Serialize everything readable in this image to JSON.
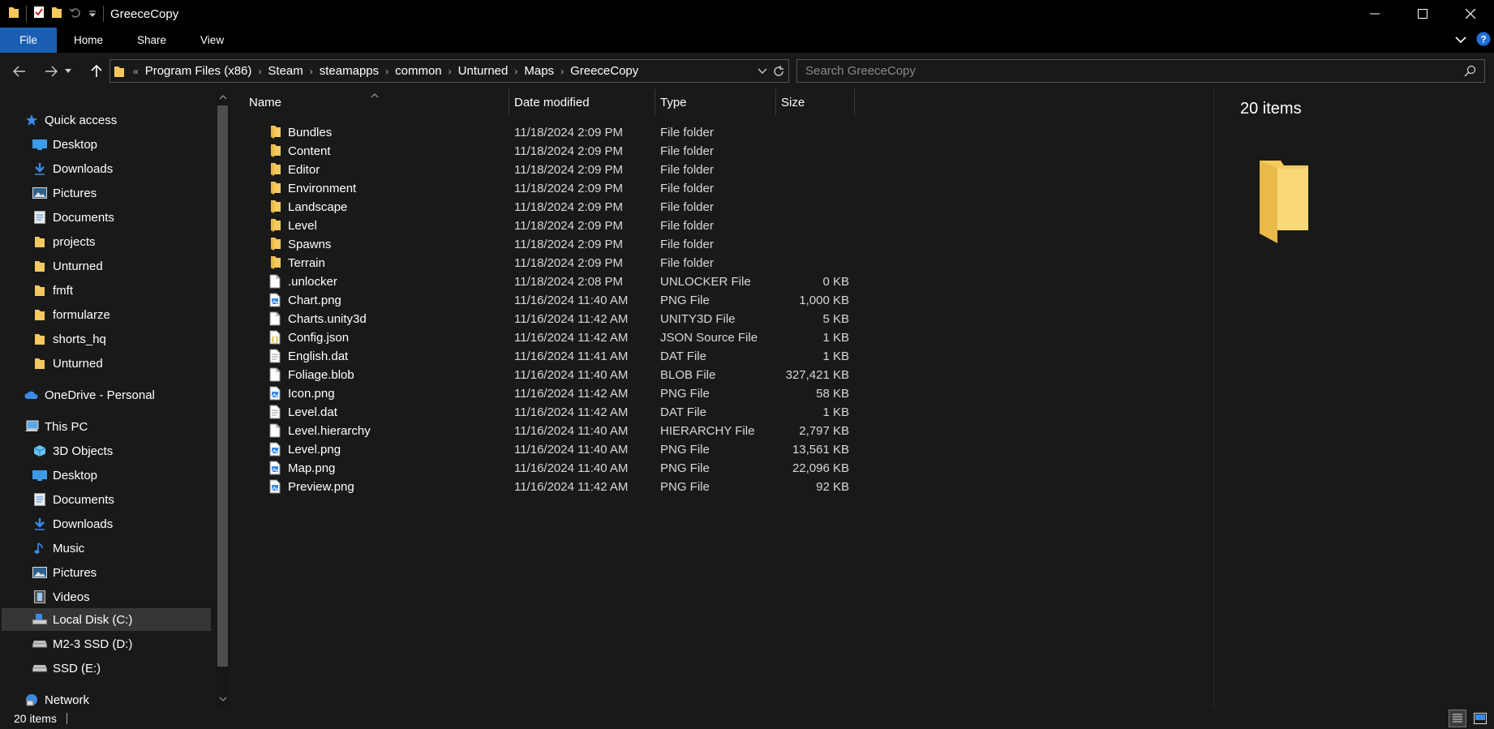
{
  "window": {
    "title": "GreeceCopy"
  },
  "ribbon": {
    "tabs": [
      "File",
      "Home",
      "Share",
      "View"
    ]
  },
  "address": {
    "overflow": "«",
    "crumbs": [
      "Program Files (x86)",
      "Steam",
      "steamapps",
      "common",
      "Unturned",
      "Maps",
      "GreeceCopy"
    ]
  },
  "search": {
    "placeholder": "Search GreeceCopy"
  },
  "nav": {
    "quick_access": "Quick access",
    "quick_items": [
      "Desktop",
      "Downloads",
      "Pictures",
      "Documents",
      "projects",
      "Unturned",
      "fmft",
      "formularze",
      "shorts_hq",
      "Unturned"
    ],
    "onedrive": "OneDrive - Personal",
    "this_pc": "This PC",
    "pc_items": [
      "3D Objects",
      "Desktop",
      "Documents",
      "Downloads",
      "Music",
      "Pictures",
      "Videos",
      "Local Disk (C:)",
      "M2-3 SSD (D:)",
      "SSD (E:)"
    ],
    "network": "Network"
  },
  "columns": {
    "name": "Name",
    "date": "Date modified",
    "type": "Type",
    "size": "Size"
  },
  "files": [
    {
      "name": "Bundles",
      "date": "11/18/2024 2:09 PM",
      "type": "File folder",
      "size": "",
      "icon": "folder"
    },
    {
      "name": "Content",
      "date": "11/18/2024 2:09 PM",
      "type": "File folder",
      "size": "",
      "icon": "folder"
    },
    {
      "name": "Editor",
      "date": "11/18/2024 2:09 PM",
      "type": "File folder",
      "size": "",
      "icon": "folder"
    },
    {
      "name": "Environment",
      "date": "11/18/2024 2:09 PM",
      "type": "File folder",
      "size": "",
      "icon": "folder"
    },
    {
      "name": "Landscape",
      "date": "11/18/2024 2:09 PM",
      "type": "File folder",
      "size": "",
      "icon": "folder"
    },
    {
      "name": "Level",
      "date": "11/18/2024 2:09 PM",
      "type": "File folder",
      "size": "",
      "icon": "folder"
    },
    {
      "name": "Spawns",
      "date": "11/18/2024 2:09 PM",
      "type": "File folder",
      "size": "",
      "icon": "folder"
    },
    {
      "name": "Terrain",
      "date": "11/18/2024 2:09 PM",
      "type": "File folder",
      "size": "",
      "icon": "folder"
    },
    {
      "name": ".unlocker",
      "date": "11/18/2024 2:08 PM",
      "type": "UNLOCKER File",
      "size": "0 KB",
      "icon": "file"
    },
    {
      "name": "Chart.png",
      "date": "11/16/2024 11:40 AM",
      "type": "PNG File",
      "size": "1,000 KB",
      "icon": "image"
    },
    {
      "name": "Charts.unity3d",
      "date": "11/16/2024 11:42 AM",
      "type": "UNITY3D File",
      "size": "5 KB",
      "icon": "file"
    },
    {
      "name": "Config.json",
      "date": "11/16/2024 11:42 AM",
      "type": "JSON Source File",
      "size": "1 KB",
      "icon": "json"
    },
    {
      "name": "English.dat",
      "date": "11/16/2024 11:41 AM",
      "type": "DAT File",
      "size": "1 KB",
      "icon": "text"
    },
    {
      "name": "Foliage.blob",
      "date": "11/16/2024 11:40 AM",
      "type": "BLOB File",
      "size": "327,421 KB",
      "icon": "file"
    },
    {
      "name": "Icon.png",
      "date": "11/16/2024 11:42 AM",
      "type": "PNG File",
      "size": "58 KB",
      "icon": "image"
    },
    {
      "name": "Level.dat",
      "date": "11/16/2024 11:42 AM",
      "type": "DAT File",
      "size": "1 KB",
      "icon": "text"
    },
    {
      "name": "Level.hierarchy",
      "date": "11/16/2024 11:40 AM",
      "type": "HIERARCHY File",
      "size": "2,797 KB",
      "icon": "file"
    },
    {
      "name": "Level.png",
      "date": "11/16/2024 11:40 AM",
      "type": "PNG File",
      "size": "13,561 KB",
      "icon": "image"
    },
    {
      "name": "Map.png",
      "date": "11/16/2024 11:40 AM",
      "type": "PNG File",
      "size": "22,096 KB",
      "icon": "image"
    },
    {
      "name": "Preview.png",
      "date": "11/16/2024 11:42 AM",
      "type": "PNG File",
      "size": "92 KB",
      "icon": "image"
    }
  ],
  "preview": {
    "count": "20 items"
  },
  "status": {
    "count": "20 items"
  },
  "colors": {
    "folder": "#f4c95d",
    "accent": "#1b5fb4",
    "selected": "#363636"
  }
}
